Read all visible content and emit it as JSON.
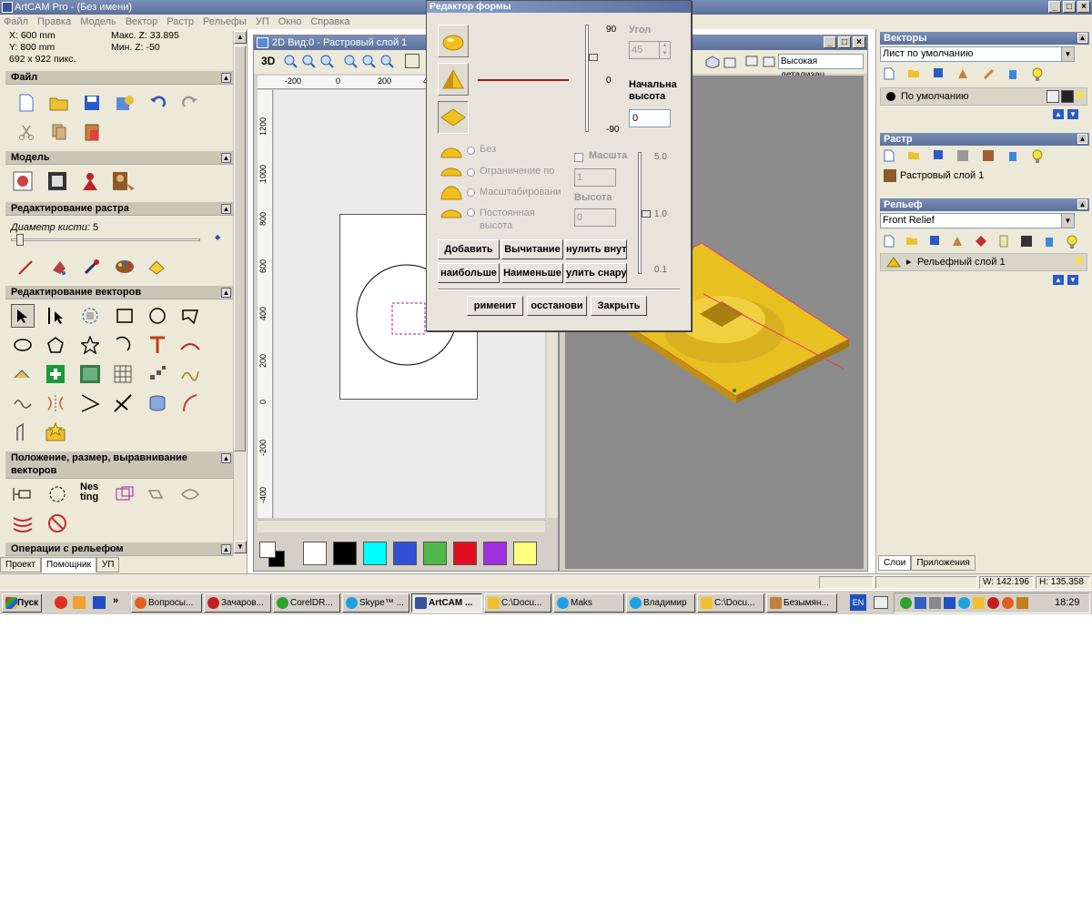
{
  "app": {
    "title": "ArtCAM Pro - (Без имени)"
  },
  "menu": [
    "Файл",
    "Правка",
    "Модель",
    "Вектор",
    "Растр",
    "Рельефы",
    "УП",
    "Окно",
    "Справка"
  ],
  "coords": {
    "x": "X: 600 mm",
    "y": "Y: 800 mm",
    "size": "692 x 922 пикс.",
    "max_z": "Макс. Z: 33.895",
    "min_z": "Мин. Z: -50"
  },
  "left": {
    "sections": {
      "file": "Файл",
      "model": "Модель",
      "raster_edit": "Редактирование растра",
      "vector_edit": "Редактирование векторов",
      "position": "Положение, размер, выравнивание векторов",
      "relief_ops": "Операции с рельефом"
    },
    "brush_label": "Диаметр кисти:",
    "brush_value": "5",
    "nesting": "Nes ting",
    "tabs": [
      "Проект",
      "Помощник",
      "УП"
    ]
  },
  "view2d": {
    "title": "2D Вид:0 - Растровый слой 1",
    "btn_3d": "3D",
    "ruler_h": [
      "-200",
      "0",
      "200",
      "4"
    ],
    "ruler_v": [
      "1200",
      "1000",
      "800",
      "600",
      "400",
      "200",
      "0",
      "-200",
      "-400"
    ]
  },
  "view3d": {
    "detail": "Высокая детализац"
  },
  "swatches": [
    "#ffffff",
    "#000000",
    "#00ffff",
    "#3050d8",
    "#50b848",
    "#e01020",
    "#a030e0",
    "#ffff80"
  ],
  "dialog": {
    "title": "Редактор формы",
    "angle_label": "Угол",
    "angle_value": "45",
    "scale_top": "90",
    "scale_mid": "0",
    "scale_bot": "-90",
    "start_height_label1": "Начальна",
    "start_height_label2": "высота",
    "start_height_value": "0",
    "radio": [
      "Без",
      "Ограничение по",
      "Масштабировани",
      "Постоянная высота"
    ],
    "scale_label": "Масшта",
    "scale_value": "1",
    "height_label": "Высота",
    "height_value": "0",
    "slider2": [
      "5.0",
      "1.0",
      "0.1"
    ],
    "btn_add": "Добавить",
    "btn_sub": "Вычитание",
    "btn_zero_in": "нулить внут",
    "btn_max": "наибольше",
    "btn_min": "Наименьше",
    "btn_zero_out": "улить снару",
    "btn_apply": "рименит",
    "btn_restore": "осстанови",
    "btn_close": "Закрыть"
  },
  "right": {
    "vectors_title": "Векторы",
    "vectors_sheet": "Лист по умолчанию",
    "vectors_layer": "По умолчанию",
    "raster_title": "Растр",
    "raster_layer": "Растровый слой 1",
    "relief_title": "Рельеф",
    "relief_combo": "Front Relief",
    "relief_layer": "Рельефный слой 1",
    "tabs": [
      "Слои",
      "Приложения"
    ]
  },
  "status": {
    "w": "W: 142.196",
    "h": "H: 135.358"
  },
  "taskbar": {
    "start": "Пуск",
    "items": [
      "Вопросы...",
      "Зачаров...",
      "CorelDR...",
      "Skype™ ...",
      "ArtCAM ...",
      "C:\\Docu...",
      "Maks",
      "Владимир",
      "C:\\Docu...",
      "Безымян..."
    ],
    "lang": "EN",
    "clock": "18:29"
  }
}
